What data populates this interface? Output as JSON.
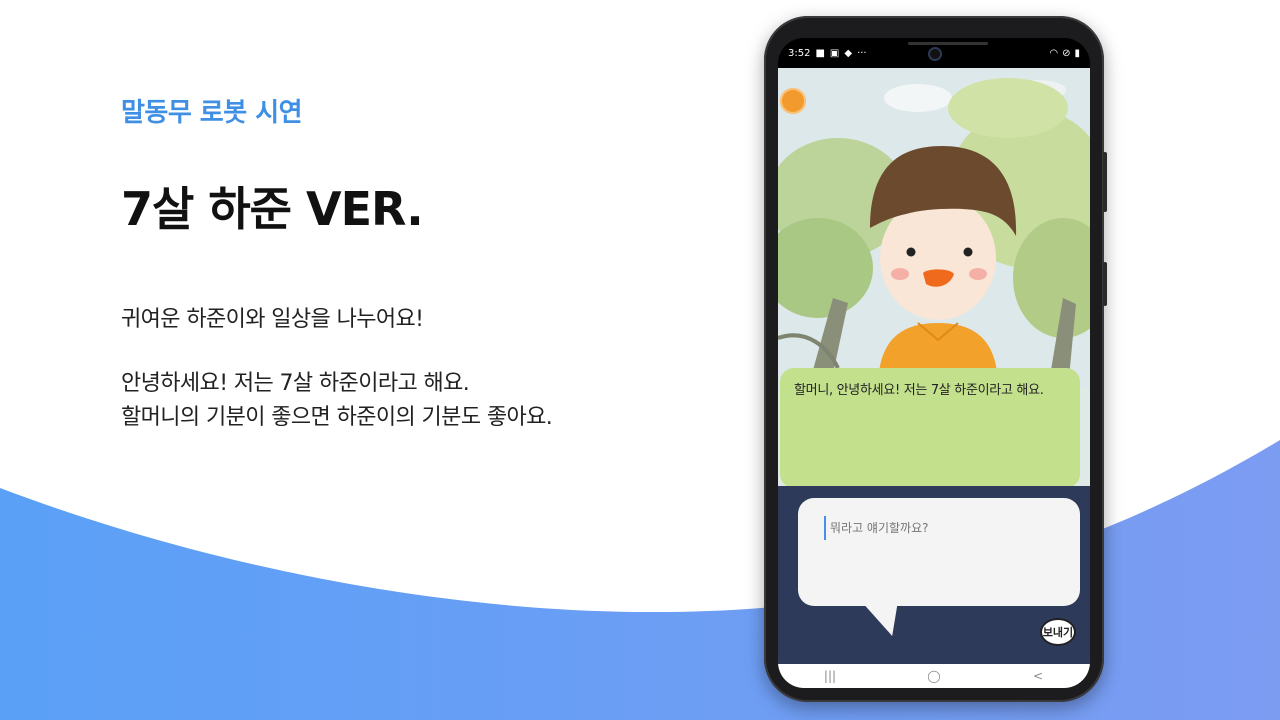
{
  "slide": {
    "kicker": "말동무 로봇 시연",
    "title": "7살 하준 VER.",
    "description": "귀여운 하준이와 일상을 나누어요!",
    "greeting_line1": "안녕하세요! 저는 7살 하준이라고 해요.",
    "greeting_line2": "할머니의 기분이 좋으면 하준이의 기분도 좋아요."
  },
  "phone": {
    "status_time": "3:52",
    "status_dots": "···",
    "chat_bubble": "할머니, 안녕하세요! 저는 7살 하준이라고 해요.",
    "input_placeholder": "뭐라고 얘기할까요?",
    "send_label": "보내기",
    "nav": {
      "recent": "|||",
      "home": "◯",
      "back": "<"
    }
  },
  "colors": {
    "accent": "#3f8fe4",
    "wave_light": "#5aa0f7",
    "wave_dark": "#7c9cf2",
    "bubble": "#c3e08d",
    "panel": "#2d3a5a",
    "orange": "#f29a2e"
  },
  "icons": {
    "status_left": [
      "video-icon",
      "image-icon",
      "bag-icon"
    ],
    "status_right": [
      "wifi-icon",
      "no-disturb-icon",
      "battery-icon"
    ]
  }
}
